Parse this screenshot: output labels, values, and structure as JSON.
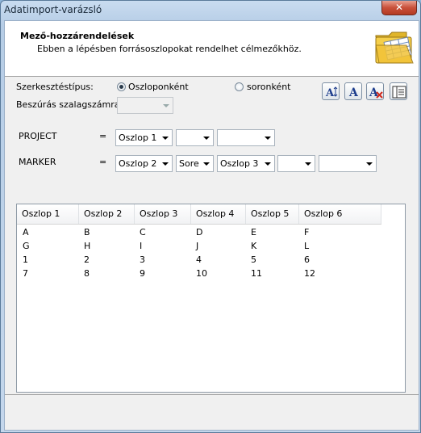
{
  "window": {
    "title": "Adatimport-varázsló",
    "close_glyph": "✕"
  },
  "header": {
    "title": "Mező-hozzárendelések",
    "subtitle": "Ebben a lépésben forrásoszlopokat rendelhet célmezőkhöz.",
    "icon": "folder-table-icon"
  },
  "edit_type": {
    "label": "Szerkesztéstípus:",
    "options": [
      {
        "label": "Oszloponként",
        "selected": true
      },
      {
        "label": "soronként",
        "selected": false
      }
    ]
  },
  "insert_ribbon": {
    "label": "Beszúrás szalagszámra:",
    "value": ""
  },
  "toolbar": {
    "buttons": [
      "text-size-icon",
      "text-format-icon",
      "clear-format-icon",
      "column-layout-icon"
    ]
  },
  "mappings": [
    {
      "field": "PROJECT",
      "equals": "=",
      "combos": [
        "Oszlop 1",
        "",
        ""
      ]
    },
    {
      "field": "MARKER",
      "equals": "=",
      "combos": [
        "Oszlop 2",
        "Sore",
        "Oszlop 3",
        "",
        ""
      ]
    }
  ],
  "preview": {
    "columns": [
      "Oszlop 1",
      "Oszlop 2",
      "Oszlop 3",
      "Oszlop 4",
      "Oszlop 5",
      "Oszlop 6"
    ],
    "rows": [
      [
        "A",
        "B",
        "C",
        "D",
        "E",
        "F"
      ],
      [
        "G",
        "H",
        "I",
        "J",
        "K",
        "L"
      ],
      [
        "1",
        "2",
        "3",
        "4",
        "5",
        "6"
      ],
      [
        "7",
        "8",
        "9",
        "10",
        "11",
        "12"
      ]
    ]
  },
  "colors": {
    "accent": "#c9503a",
    "window_frame": "#b6cde6"
  }
}
